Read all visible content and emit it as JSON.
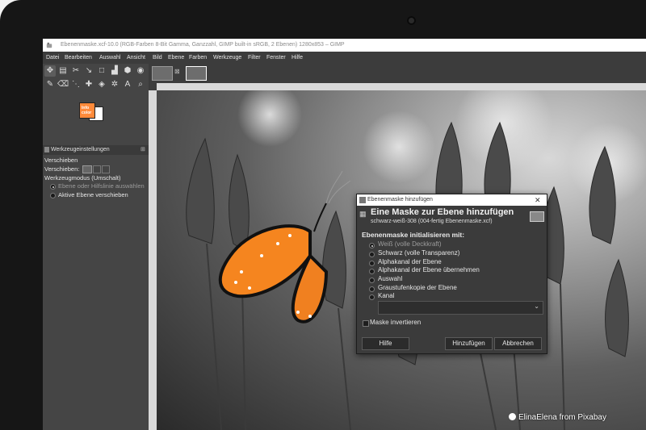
{
  "window": {
    "title": "Ebenenmaske.xcf-10.0 (RGB-Farben 8-Bit Gamma, Ganzzahl, GIMP built-in sRGB, 2 Ebenen) 1280x853 – GIMP"
  },
  "menubar": {
    "items": [
      "Datei",
      "Bearbeiten",
      "Auswahl",
      "Ansicht",
      "Bild",
      "Ebene",
      "Farben",
      "Werkzeuge",
      "Filter",
      "Fenster",
      "Hilfe"
    ]
  },
  "toolbox": {
    "tools": [
      "move-tool",
      "align-tool",
      "crop-tool",
      "rotate-tool",
      "scale-tool",
      "fuzzy-select-tool",
      "paths-tool",
      "text-tool",
      "paint-tool",
      "eraser-tool",
      "fill-tool",
      "smudge-tool",
      "dodge-tool",
      "color-picker-tool",
      "zoom-tool",
      "measure-tool"
    ],
    "color_fg_label": "Info\ncolor",
    "panel_title": "Werkzeugeinstellungen",
    "tool_name": "Verschieben",
    "move_label": "Verschieben:",
    "mode_label": "Werkzeugmodus (Umschalt)",
    "mode_option_1": "Ebene oder Hilfslinie auswählen",
    "mode_option_2": "Aktive Ebene verschieben"
  },
  "dialog": {
    "titlebar": "Ebenenmaske hinzufügen",
    "close_glyph": "✕",
    "heading": "Eine Maske zur Ebene hinzufügen",
    "subheading": "schwarz-weiß-308 (004-fertig Ebenenmaske.xcf)",
    "section": "Ebenenmaske initialisieren mit:",
    "options": [
      "Weiß (volle Deckkraft)",
      "Schwarz (volle Transparenz)",
      "Alphakanal der Ebene",
      "Alphakanal der Ebene übernehmen",
      "Auswahl",
      "Graustufenkopie der Ebene",
      "Kanal"
    ],
    "selected_option": "Weiß (volle Deckkraft)",
    "select_value": "",
    "invert_label": "Maske invertieren",
    "invert_checked": false,
    "buttons": {
      "help": "Hilfe",
      "add": "Hinzufügen",
      "cancel": "Abbrechen"
    }
  },
  "credit": {
    "text": "ElinaElena from Pixabay"
  },
  "colors": {
    "accent_orange": "#f5851f",
    "gimp_dark": "#454545",
    "dialog_bg": "#3b3b3b"
  }
}
